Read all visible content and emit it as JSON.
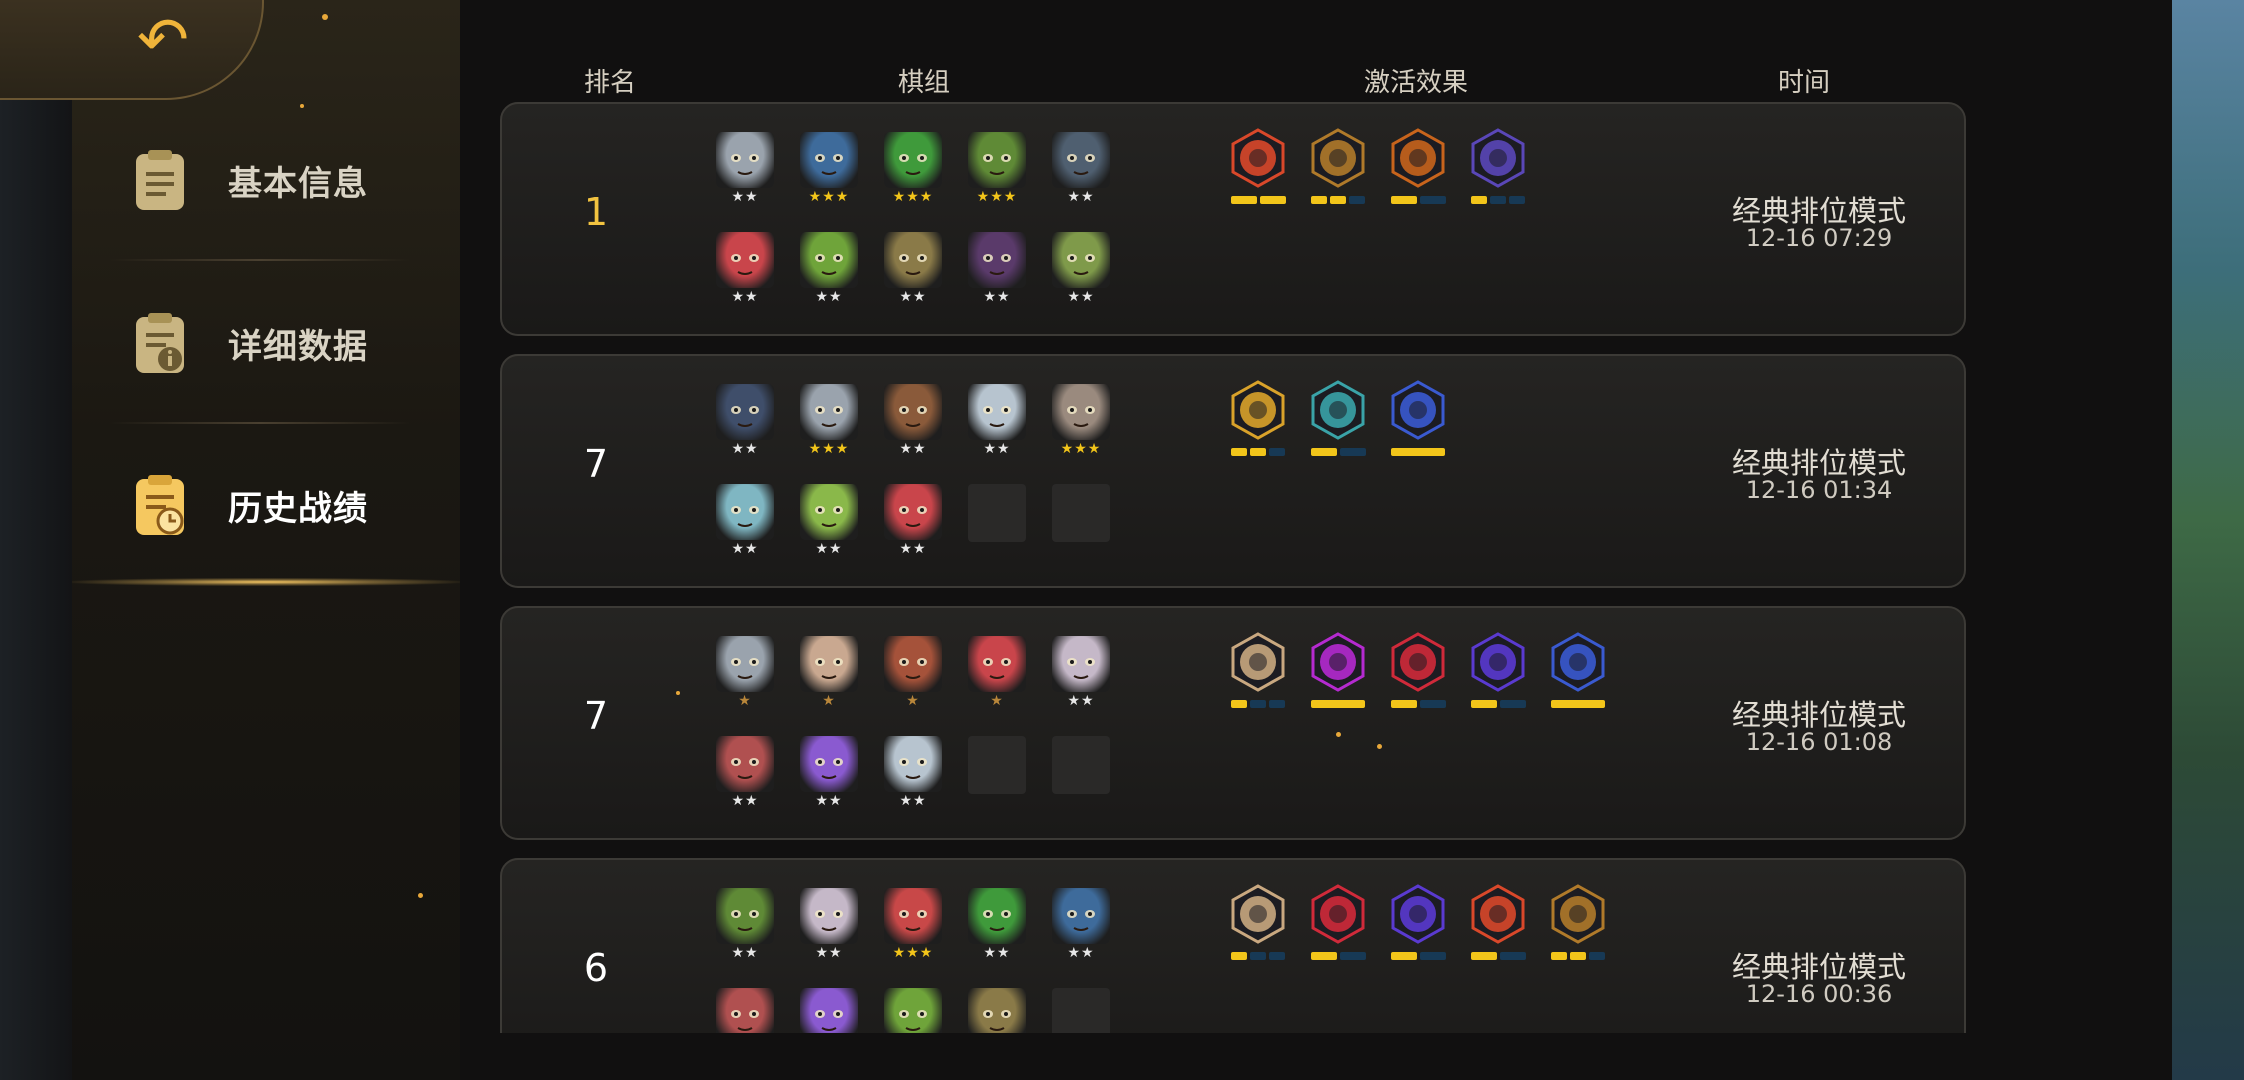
{
  "nav": {
    "back_icon": "back-arrow-icon",
    "items": [
      {
        "label": "基本信息",
        "icon": "document-icon",
        "active": false
      },
      {
        "label": "详细数据",
        "icon": "document-info-icon",
        "active": false
      },
      {
        "label": "历史战绩",
        "icon": "document-clock-icon",
        "active": true
      }
    ]
  },
  "headers": {
    "rank": "排名",
    "team": "棋组",
    "effects": "激活效果",
    "time": "时间"
  },
  "colors": {
    "gold": "#f2c340",
    "pip_active": "#f2c51a",
    "pip_inactive": "#173955",
    "accent": "#f0b43a"
  },
  "matches": [
    {
      "rank": "1",
      "mode": "经典排位模式",
      "time": "12-16 07:29",
      "units": [
        {
          "name": "gray-ogre",
          "stars": 2,
          "color": "#9aa3ad"
        },
        {
          "name": "blue-robot",
          "stars": 3,
          "color": "#3e6b9b"
        },
        {
          "name": "green-goblin-bandit",
          "stars": 3,
          "color": "#3f9a3b"
        },
        {
          "name": "goblin-helmet",
          "stars": 3,
          "color": "#5f8a36"
        },
        {
          "name": "mech-golem",
          "stars": 2,
          "color": "#4f5f70"
        },
        {
          "name": "red-hood",
          "stars": 2,
          "color": "#c9454b"
        },
        {
          "name": "goblin-red-cap",
          "stars": 2,
          "color": "#6fa43a"
        },
        {
          "name": "goblin-hooded",
          "stars": 2,
          "color": "#8a7a48"
        },
        {
          "name": "purple-mask",
          "stars": 2,
          "color": "#5a3a6a"
        },
        {
          "name": "goblin-techie",
          "stars": 2,
          "color": "#7f9a4a"
        }
      ],
      "traits": [
        {
          "name": "demon-trait-icon",
          "color": "#d9482a",
          "level": 2,
          "max": 2
        },
        {
          "name": "gear-trait-icon",
          "color": "#b07a2a",
          "level": 2,
          "max": 3
        },
        {
          "name": "leaf-trait-icon",
          "color": "#c8641c",
          "level": 1,
          "max": 2
        },
        {
          "name": "mage-trait-icon",
          "color": "#5a47b8",
          "level": 1,
          "max": 3
        }
      ]
    },
    {
      "rank": "7",
      "mode": "经典排位模式",
      "time": "12-16 01:34",
      "units": [
        {
          "name": "blue-visor",
          "stars": 2,
          "color": "#3f4e6a"
        },
        {
          "name": "gray-ogre",
          "stars": 3,
          "color": "#9aa3ad"
        },
        {
          "name": "turban-warrior",
          "stars": 2,
          "color": "#8a5a3a"
        },
        {
          "name": "horned-yeti",
          "stars": 2,
          "color": "#b7c4cf"
        },
        {
          "name": "white-beard",
          "stars": 3,
          "color": "#9a8a7e"
        },
        {
          "name": "cyan-cow",
          "stars": 2,
          "color": "#7fb6c2"
        },
        {
          "name": "green-bird",
          "stars": 2,
          "color": "#8ab84a"
        },
        {
          "name": "red-hood",
          "stars": 2,
          "color": "#c9454b"
        },
        {
          "name": "empty",
          "stars": 0,
          "color": ""
        },
        {
          "name": "empty",
          "stars": 0,
          "color": ""
        }
      ],
      "traits": [
        {
          "name": "spirit-trait-icon",
          "color": "#d9a22a",
          "level": 2,
          "max": 3
        },
        {
          "name": "mystery-trait-icon",
          "color": "#3aa3a8",
          "level": 1,
          "max": 2
        },
        {
          "name": "elemental-trait-icon",
          "color": "#3a5ad0",
          "level": 1,
          "max": 1
        }
      ]
    },
    {
      "rank": "7",
      "mode": "经典排位模式",
      "time": "12-16 01:08",
      "units": [
        {
          "name": "gray-ogre",
          "stars": 1,
          "color": "#9aa3ad"
        },
        {
          "name": "masked-cow",
          "stars": 1,
          "color": "#c9a890"
        },
        {
          "name": "bearded-dwarf",
          "stars": 1,
          "color": "#a5523a"
        },
        {
          "name": "red-hood",
          "stars": 1,
          "color": "#c9454b"
        },
        {
          "name": "white-ape",
          "stars": 2,
          "color": "#c5b8c8"
        },
        {
          "name": "bandit-mask",
          "stars": 2,
          "color": "#b05050"
        },
        {
          "name": "purple-wisp",
          "stars": 2,
          "color": "#8a5ad0"
        },
        {
          "name": "horned-yeti",
          "stars": 2,
          "color": "#b7c4cf"
        },
        {
          "name": "empty",
          "stars": 0,
          "color": ""
        },
        {
          "name": "empty",
          "stars": 0,
          "color": ""
        }
      ],
      "traits": [
        {
          "name": "axe-trait-icon",
          "color": "#c9a880",
          "level": 1,
          "max": 3
        },
        {
          "name": "demon-cat-trait-icon",
          "color": "#b52ad0",
          "level": 1,
          "max": 1
        },
        {
          "name": "arch-trait-icon",
          "color": "#d02a3a",
          "level": 1,
          "max": 2
        },
        {
          "name": "skeleton-trait-icon",
          "color": "#5a3ad0",
          "level": 1,
          "max": 2
        },
        {
          "name": "elemental-trait-icon",
          "color": "#3a5ad0",
          "level": 1,
          "max": 1
        }
      ]
    },
    {
      "rank": "6",
      "mode": "经典排位模式",
      "time": "12-16 00:36",
      "units": [
        {
          "name": "goblin-helmet",
          "stars": 2,
          "color": "#5f8a36"
        },
        {
          "name": "white-ape",
          "stars": 2,
          "color": "#c5b8c8"
        },
        {
          "name": "red-beast",
          "stars": 3,
          "color": "#c84848"
        },
        {
          "name": "green-goblin-bandit",
          "stars": 2,
          "color": "#3f9a3b"
        },
        {
          "name": "blue-robot",
          "stars": 2,
          "color": "#3e6b9b"
        },
        {
          "name": "bandit-mask",
          "stars": 0,
          "color": "#b05050"
        },
        {
          "name": "purple-wisp",
          "stars": 0,
          "color": "#8a5ad0"
        },
        {
          "name": "goblin-red-cap",
          "stars": 0,
          "color": "#6fa43a"
        },
        {
          "name": "goblin-hooded",
          "stars": 0,
          "color": "#8a7a48"
        },
        {
          "name": "empty",
          "stars": 0,
          "color": ""
        }
      ],
      "traits": [
        {
          "name": "axe-trait-icon",
          "color": "#c9a880",
          "level": 1,
          "max": 3
        },
        {
          "name": "arch-trait-icon",
          "color": "#d02a3a",
          "level": 1,
          "max": 2
        },
        {
          "name": "skeleton-trait-icon",
          "color": "#5a3ad0",
          "level": 1,
          "max": 2
        },
        {
          "name": "demon-trait-icon",
          "color": "#d9482a",
          "level": 1,
          "max": 2
        },
        {
          "name": "gear-trait-icon",
          "color": "#b07a2a",
          "level": 2,
          "max": 3
        }
      ]
    }
  ]
}
